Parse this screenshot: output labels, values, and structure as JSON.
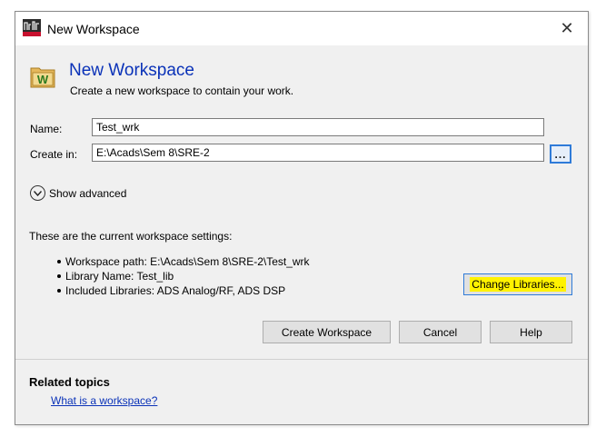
{
  "window": {
    "title": "New Workspace",
    "close_glyph": "✕",
    "app_icon": "ads-app-icon"
  },
  "header": {
    "title": "New Workspace",
    "subtitle": "Create a new workspace to contain your work.",
    "icon": "workspace-folder-icon"
  },
  "form": {
    "name_label": "Name:",
    "name_value": "Test_wrk",
    "create_in_label": "Create in:",
    "create_in_value": "E:\\Acads\\Sem 8\\SRE-2",
    "browse_label": "..."
  },
  "advanced": {
    "label": "Show advanced"
  },
  "settings": {
    "caption": "These are the current workspace settings:",
    "items": [
      "Workspace path:  E:\\Acads\\Sem 8\\SRE-2\\Test_wrk",
      "Library Name:  Test_lib",
      "Included Libraries:  ADS Analog/RF, ADS DSP"
    ],
    "change_libraries_label": "Change Libraries..."
  },
  "buttons": {
    "create": "Create Workspace",
    "cancel": "Cancel",
    "help": "Help"
  },
  "related": {
    "title": "Related topics",
    "link": "What is a workspace?"
  },
  "colors": {
    "accent": "#0a32b8",
    "highlight": "#fff200",
    "focus_border": "#2f7bd8"
  }
}
